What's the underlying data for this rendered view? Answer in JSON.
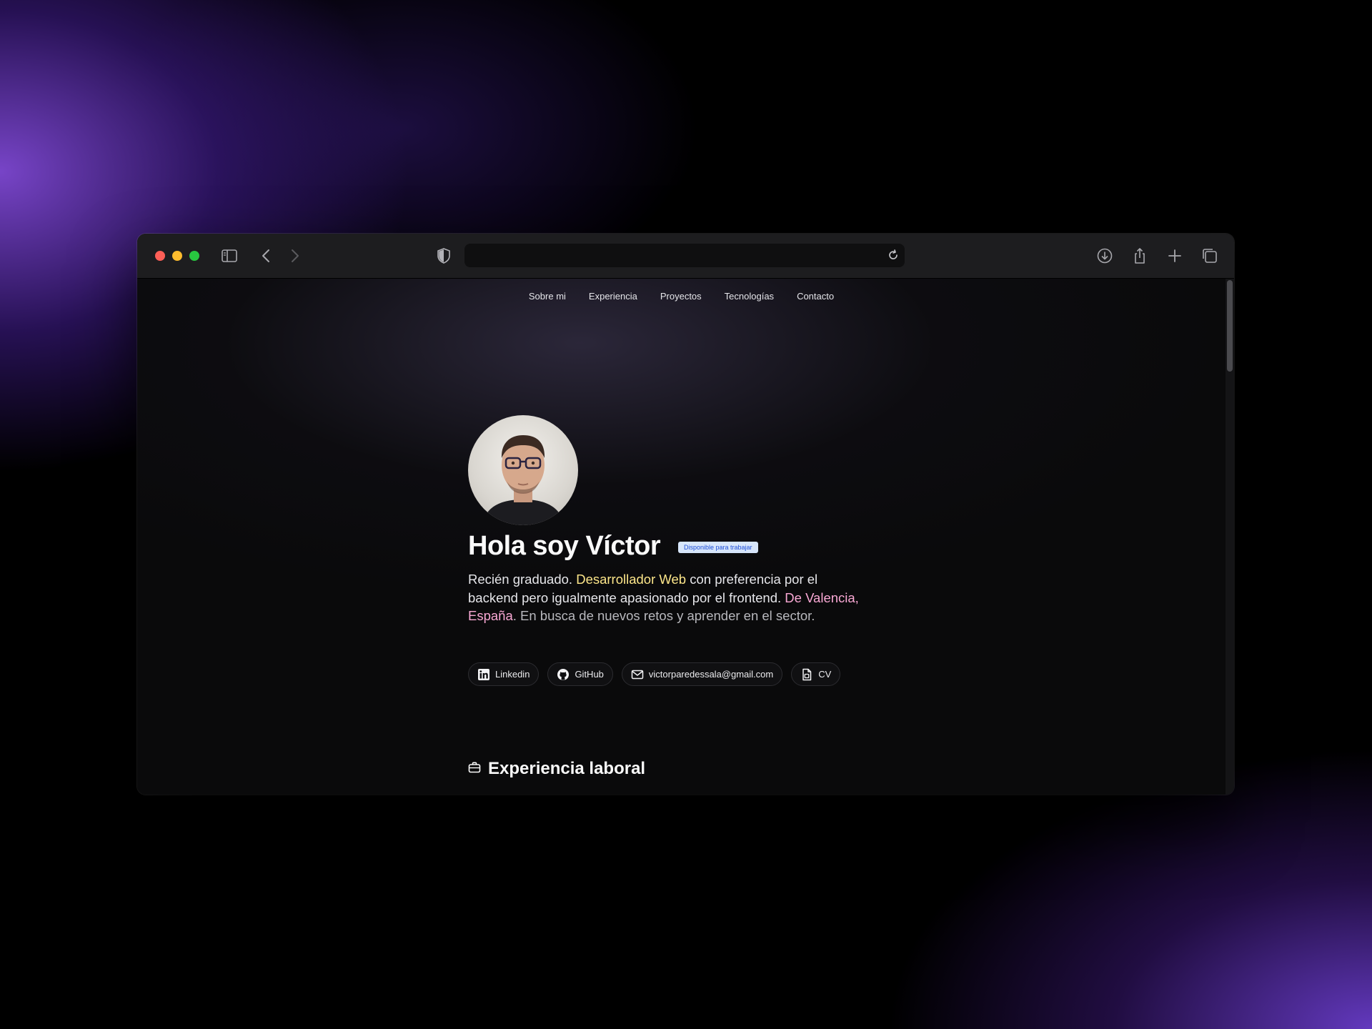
{
  "nav": {
    "items": [
      "Sobre mi",
      "Experiencia",
      "Proyectos",
      "Tecnologías",
      "Contacto"
    ]
  },
  "hero": {
    "title": "Hola soy Víctor",
    "badge": "Disponible para trabajar",
    "text": {
      "part1": "Recién graduado. ",
      "highlight1": "Desarrollador Web",
      "part2": " con preferencia por el backend pero igualmente apasionado por el frontend. ",
      "highlight2": "De Valencia, España",
      "part3": ". En busca de nuevos retos y aprender en el sector."
    }
  },
  "links": {
    "linkedin": "Linkedin",
    "github": "GitHub",
    "email": "victorparedessala@gmail.com",
    "cv": "CV"
  },
  "sections": {
    "experience_title": "Experiencia laboral"
  },
  "colors": {
    "highlight_yellow": "#fde68a",
    "highlight_pink": "#f9a8d4",
    "badge_bg": "#d7e6fb",
    "badge_text": "#1d4ed8"
  },
  "icons": [
    "sidebar-icon",
    "back-icon",
    "forward-icon",
    "shield-icon",
    "reload-icon",
    "download-icon",
    "share-icon",
    "plus-icon",
    "tabs-icon",
    "linkedin-icon",
    "github-icon",
    "mail-icon",
    "document-icon",
    "briefcase-icon"
  ]
}
